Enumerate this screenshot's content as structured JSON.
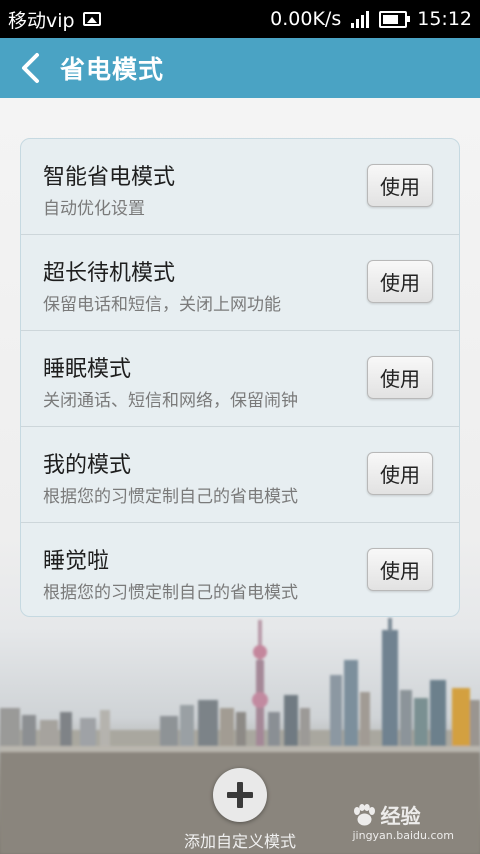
{
  "status_bar": {
    "carrier": "移动vip",
    "speed": "0.00K/s",
    "time": "15:12"
  },
  "app_bar": {
    "title": "省电模式"
  },
  "modes": [
    {
      "title": "智能省电模式",
      "desc": "自动优化设置",
      "button": "使用"
    },
    {
      "title": "超长待机模式",
      "desc": "保留电话和短信，关闭上网功能",
      "button": "使用"
    },
    {
      "title": "睡眠模式",
      "desc": "关闭通话、短信和网络，保留闹钟",
      "button": "使用"
    },
    {
      "title": "我的模式",
      "desc": "根据您的习惯定制自己的省电模式",
      "button": "使用"
    },
    {
      "title": "睡觉啦",
      "desc": "根据您的习惯定制自己的省电模式",
      "button": "使用"
    }
  ],
  "add_mode": {
    "label": "添加自定义模式"
  },
  "watermark": {
    "brand": "经验",
    "url": "jingyan.baidu.com"
  },
  "colors": {
    "app_bar": "#4aa3c4",
    "card_bg": "#e7eef1"
  }
}
